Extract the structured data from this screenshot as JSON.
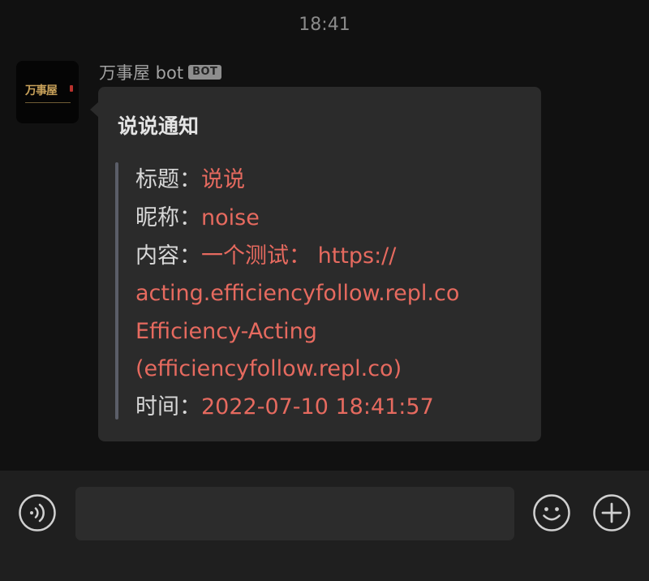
{
  "chat": {
    "timestamp": "18:41"
  },
  "message": {
    "avatar_text": "万事屋",
    "sender_name": "万事屋 bot",
    "sender_badge": "BOT",
    "card_title": "说说通知",
    "fields": [
      {
        "label": "标题：",
        "lines": [
          "说说"
        ]
      },
      {
        "label": "昵称：",
        "lines": [
          "noise"
        ]
      },
      {
        "label": "内容：",
        "lines": [
          "一个测试：  https://",
          "acting.efficiencyfollow.repl.co",
          "Efficiency-Acting",
          "(efficiencyfollow.repl.co)"
        ]
      },
      {
        "label": "时间：",
        "lines": [
          "2022-07-10 18:41:57"
        ]
      }
    ]
  },
  "composer": {
    "input_value": "",
    "icons": {
      "voice": "voice-icon",
      "emoji": "emoji-icon",
      "more": "plus-icon"
    }
  },
  "colors": {
    "background": "#111111",
    "bubble": "#2b2b2b",
    "accent": "#e66a5f",
    "label": "#d8d8d8"
  }
}
